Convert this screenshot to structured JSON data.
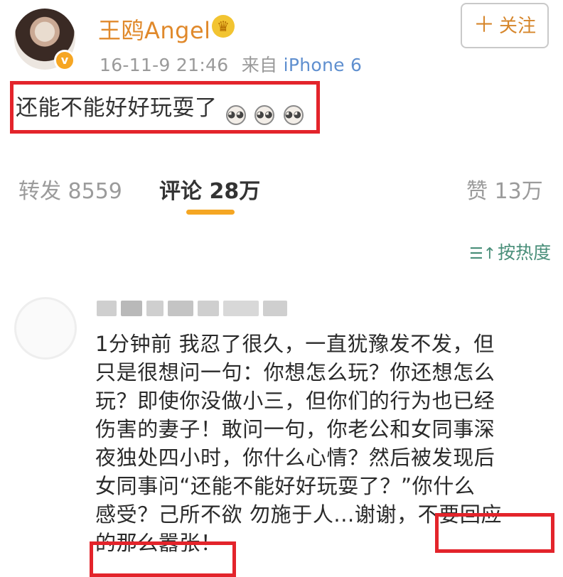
{
  "post": {
    "username": "王鸥Angel",
    "time": "16-11-9 21:46",
    "source_prefix": "来自",
    "device": "iPhone 6",
    "follow_label": "关注",
    "text": "还能不能好好玩耍了"
  },
  "stats": {
    "repost_label": "转发",
    "repost_count": "8559",
    "comment_label": "评论",
    "comment_count": "28万",
    "like_label": "赞",
    "like_count": "13万"
  },
  "sort_label": "按热度",
  "comment": {
    "lines": [
      "1分钟前 我忍了很久，一直犹豫发不发，但",
      "只是很想问一句：你想怎么玩？你还想怎么",
      "玩？即使你没做小三，但你们的行为也已经",
      "伤害的妻子！敢问一句，你老公和女同事深",
      "夜独处四小时，你什么心情？然后被发现后",
      "女同事问“还能不能好好玩耍了？”你什么",
      "感受？己所不欲 勿施于人...谢谢，不要回应",
      "的那么嚣张！"
    ]
  },
  "colors": {
    "username": "#e0892b",
    "device": "#5f8fcf",
    "highlight": "#e3242b",
    "active_tab_underline": "#f5a623",
    "sort": "#4a8f7a"
  },
  "icons": [
    "verified-badge-icon",
    "crown-icon",
    "plus-icon",
    "laugh-cry-emoji-icon",
    "sort-icon"
  ]
}
